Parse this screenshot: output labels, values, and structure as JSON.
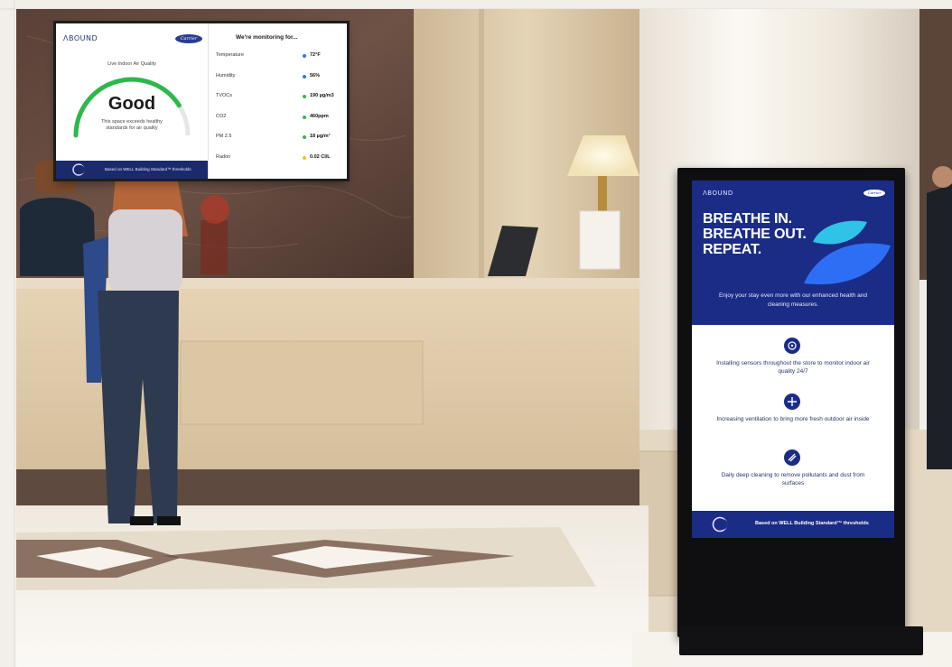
{
  "wall_display": {
    "brand": "ΛBOUND",
    "partner": "Carrier",
    "air_quality_label": "Live Indoor Air Quality",
    "status": "Good",
    "gauge_fraction": 0.82,
    "status_description": "This space exceeds healthy standards for air quality",
    "monitoring_title": "We're monitoring for...",
    "metrics": [
      {
        "label": "Temperature",
        "value": "72°F",
        "color": "#2e7bd6"
      },
      {
        "label": "Humidity",
        "value": "56%",
        "color": "#2e7bd6"
      },
      {
        "label": "TVOCs",
        "value": "190 µg/m3",
        "color": "#3bb54a"
      },
      {
        "label": "CO2",
        "value": "460ppm",
        "color": "#3bb54a"
      },
      {
        "label": "PM 2.5",
        "value": "18 µg/m³",
        "color": "#3bb54a"
      },
      {
        "label": "Radon",
        "value": "0.02 CI/L",
        "color": "#f0c419"
      }
    ],
    "footer_text": "Based on WELL Building Standard™ thresholds"
  },
  "kiosk": {
    "brand": "ΛBOUND",
    "partner": "Carrier",
    "headline": [
      "BREATHE IN.",
      "BREATHE OUT.",
      "REPEAT."
    ],
    "subtitle": "Enjoy your stay even more with our enhanced health and cleaning measures.",
    "items": [
      {
        "icon": "sensor-icon",
        "text": "Installing sensors throughout the store to monitor indoor air quality 24/7"
      },
      {
        "icon": "fan-icon",
        "text": "Increasing ventilation to bring more fresh outdoor air inside"
      },
      {
        "icon": "cleaning-icon",
        "text": "Daily deep cleaning to remove pollutants and dust from surfaces"
      }
    ],
    "footer_text": "Based on WELL Building Standard™ thresholds"
  },
  "colors": {
    "navy": "#1a2c85",
    "gauge_green": "#2cb84a",
    "accent_blue": "#2d6ef5",
    "accent_cyan": "#2fc3e8"
  }
}
